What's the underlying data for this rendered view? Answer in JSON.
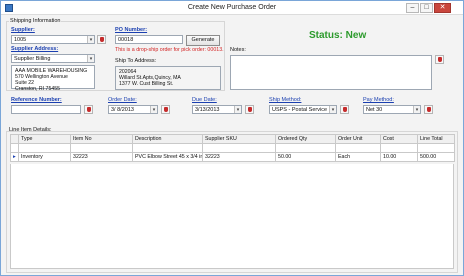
{
  "window": {
    "title": "Create New Purchase Order",
    "min": "–",
    "max": "□",
    "close": "✕"
  },
  "shipping": {
    "group_label": "Shipping Information",
    "supplier_label": "Supplier:",
    "supplier_value": "1005",
    "supplier_address_label": "Supplier Address:",
    "supplier_address_select": "Supplier Billing",
    "supplier_address_lines": [
      "AAA MOBILE WAREHOUSING",
      "570 Wellington Avenue",
      "Suite 22",
      "Cranston, RI 75455"
    ],
    "po_number_label": "PO Number:",
    "po_number_value": "00018",
    "generate_label": "Generate",
    "dropship_warning": "This is a drop-ship order for pick order: 00013.",
    "ship_to_label": "Ship To Address:",
    "ship_to_lines": [
      "202064",
      "Willard St.Apts,Quincy, MA",
      "1377 W. Cust Billing St."
    ]
  },
  "status": {
    "text": "Status: New"
  },
  "notes": {
    "label": "Notes:",
    "value": ""
  },
  "fields": {
    "reference_label": "Reference Number:",
    "reference_value": "",
    "order_date_label": "Order Date:",
    "order_date_value": "3/ 8/2013",
    "due_date_label": "Due Date:",
    "due_date_value": "3/13/2013",
    "ship_method_label": "Ship Method:",
    "ship_method_value": "USPS - Postal Service",
    "pay_method_label": "Pay Method:",
    "pay_method_value": "Net 30"
  },
  "line_items": {
    "group_label": "Line Item Details:",
    "columns": [
      "Type",
      "Item No",
      "Description",
      "Supplier SKU",
      "Ordered Qty",
      "Order Unit",
      "Cost",
      "Line Total"
    ],
    "rows": [
      {
        "type": "Inventory",
        "item_no": "32223",
        "description": "PVC Elbow Street 45 x 3/4 in",
        "sku": "32223",
        "qty": "50.00",
        "unit": "Each",
        "cost": "10.00",
        "total": "500.00"
      }
    ]
  }
}
